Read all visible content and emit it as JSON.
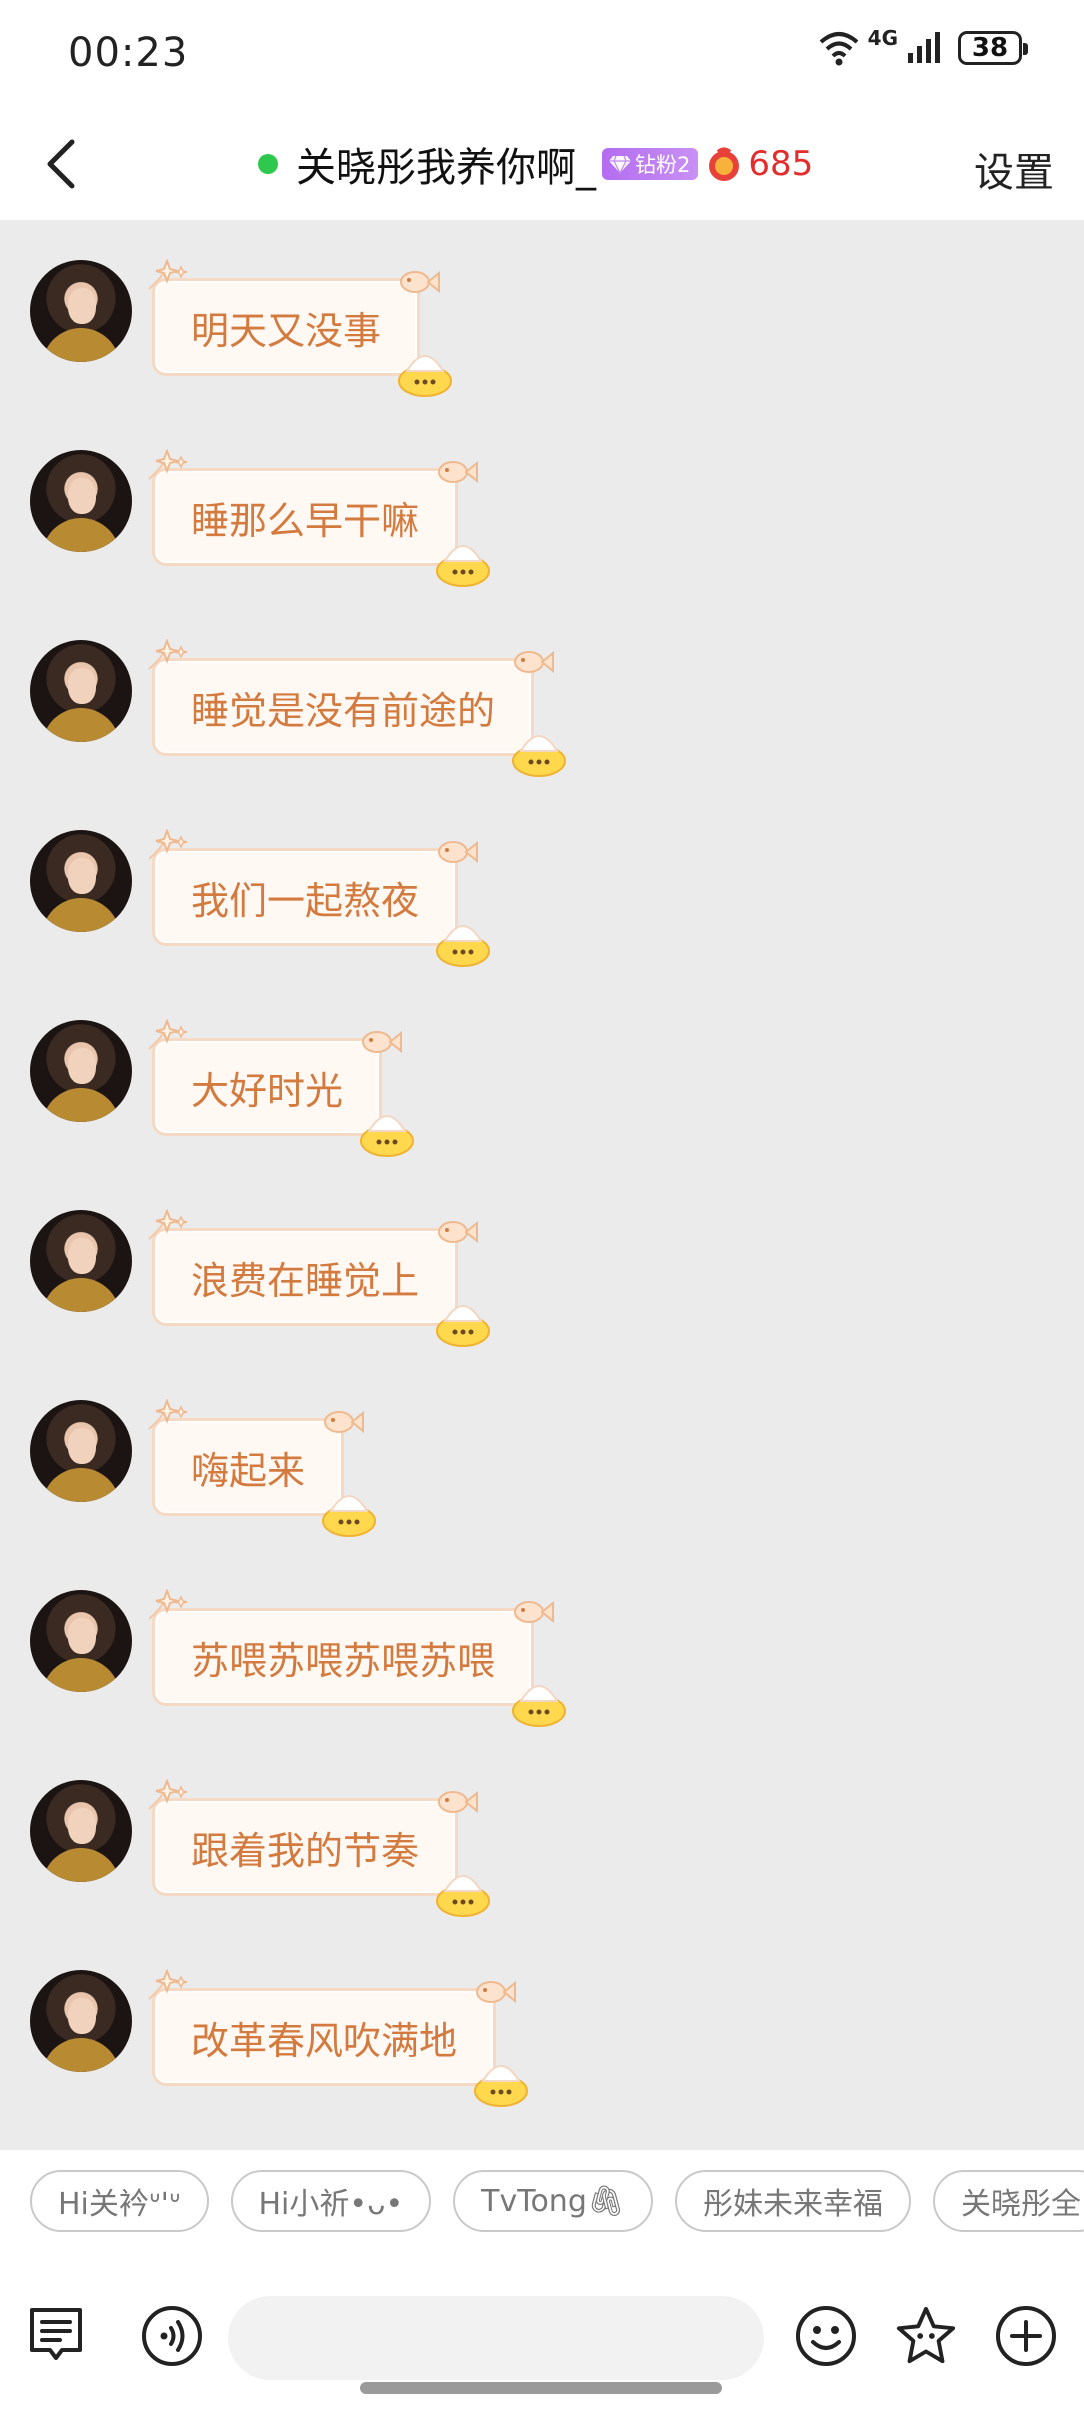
{
  "status_bar": {
    "time": "00:23",
    "network": "4G",
    "battery": "38"
  },
  "header": {
    "title": "关晓彤我养你啊_",
    "fan_badge": "钻粉2",
    "fortune_value": "685",
    "settings_label": "设置",
    "online_color": "#2ec94c"
  },
  "messages": [
    {
      "text": "明天又没事"
    },
    {
      "text": "睡那么早干嘛"
    },
    {
      "text": "睡觉是没有前途的"
    },
    {
      "text": "我们一起熬夜"
    },
    {
      "text": "大好时光"
    },
    {
      "text": "浪费在睡觉上"
    },
    {
      "text": "嗨起来"
    },
    {
      "text": "苏喂苏喂苏喂苏喂"
    },
    {
      "text": "跟着我的节奏"
    },
    {
      "text": "改革春风吹满地"
    }
  ],
  "quick_replies": [
    "Hi关衿ᐡ'ᐡ",
    "Hi小祈•ᴗ•",
    "TvTong🖇",
    "彤妹未来幸福",
    "关晓彤全"
  ],
  "input": {
    "placeholder": ""
  },
  "icons": {
    "back": "back-arrow-icon",
    "doc": "notes-icon",
    "voice": "voice-icon",
    "emoji": "emoji-icon",
    "sticker": "star-face-icon",
    "add": "plus-circle-icon"
  },
  "colors": {
    "bubble_text": "#d37a3f",
    "bubble_bg": "#fff8f3",
    "chat_bg": "#ebebeb",
    "fortune": "#e32c2c"
  }
}
